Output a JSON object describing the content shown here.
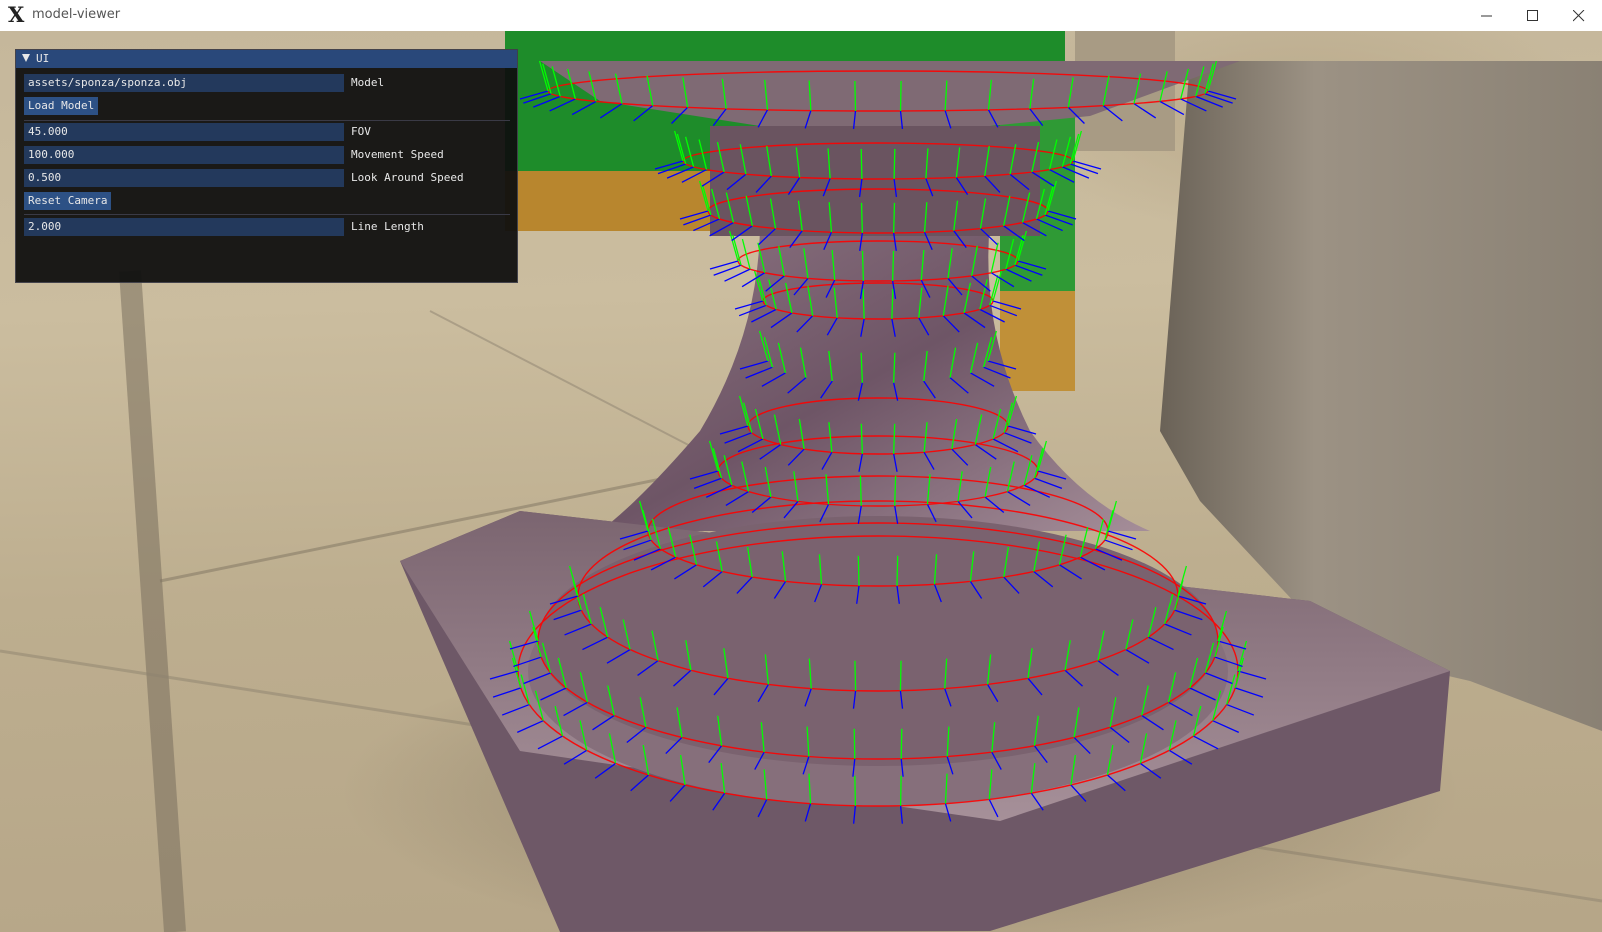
{
  "window": {
    "title": "model-viewer",
    "logo_glyph": "X",
    "buttons": [
      "minimize-icon",
      "maximize-icon",
      "close-icon"
    ]
  },
  "ui_panel": {
    "title": "UI",
    "model_path": "assets/sponza/sponza.obj",
    "model_label": "Model",
    "load_button": "Load Model",
    "fov_value": "45.000",
    "fov_label": "FOV",
    "movement_speed_value": "100.000",
    "movement_speed_label": "Movement Speed",
    "look_speed_value": "0.500",
    "look_speed_label": "Look Around Speed",
    "reset_button": "Reset Camera",
    "line_length_value": "2.000",
    "line_length_label": "Line Length"
  },
  "colors": {
    "normal_line": "#0000ff",
    "tangent_line": "#ff0000",
    "bitangent_line": "#00ff00",
    "imgui_title_bg": "#29487a",
    "imgui_field_bg": "#23395c",
    "imgui_button_bg": "#2d5185"
  }
}
